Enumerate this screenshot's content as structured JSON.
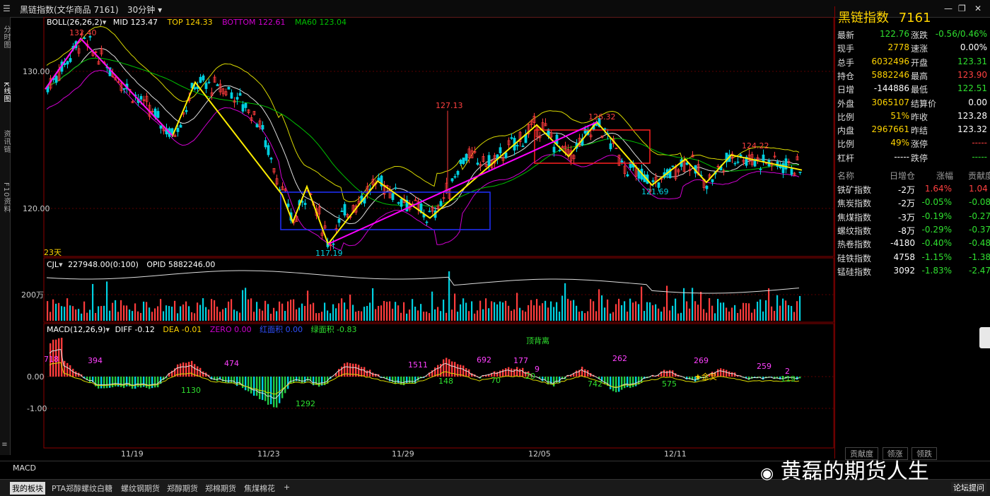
{
  "window": {
    "title": "黑链指数(文华商品 7161)",
    "period": "30分钟",
    "controls": [
      "—",
      "❐",
      "✕"
    ]
  },
  "left_tabs": [
    "分时图",
    "K线图",
    "资讯链",
    "F10资料"
  ],
  "chart": {
    "boll_legend": {
      "name": "BOLL(26,26,2)",
      "mid": "MID 123.47",
      "top": "TOP 124.33",
      "bottom": "BOTTOM 122.61",
      "ma60": "MA60 123.04"
    },
    "price_ticks": [
      "130.00",
      "120.00"
    ],
    "date_ticks": [
      "11/19",
      "11/23",
      "11/29",
      "12/05",
      "12/11"
    ],
    "days_label": "23天",
    "price_labels": {
      "high1": "132.40",
      "low1": "117.19",
      "spike": "127.13",
      "high2": "126.32",
      "low2": "121.69",
      "high3": "124.22"
    },
    "vol_legend": {
      "name": "CJL",
      "value": "227948.00(0:100)",
      "opid": "OPID 5882246.00"
    },
    "vol_tick": "200万",
    "macd_legend": {
      "name": "MACD(12,26,9)",
      "diff": "DIFF -0.12",
      "dea": "DEA -0.01",
      "zero": "ZERO 0.00",
      "red_area": "红面积 0.00",
      "green_area": "绿面积 -0.83"
    },
    "macd_ticks": [
      "0.00",
      "-1.00"
    ],
    "macd_annotations": [
      "718",
      "394",
      "1130",
      "474",
      "1292",
      "1511",
      "148",
      "692",
      "70",
      "177",
      "9",
      "20",
      "顶背离",
      "742",
      "262",
      "575",
      "269",
      "★金叉",
      "259",
      "2",
      "119"
    ]
  },
  "chart_data": {
    "type": "candlestick",
    "title": "黑链指数(文华商品 7161)",
    "period": "30分钟",
    "x_labels": [
      "11/19",
      "11/23",
      "11/29",
      "12/05",
      "12/11"
    ],
    "price_range": [
      116.5,
      133
    ],
    "key_points": [
      {
        "label": "132.40",
        "kind": "high"
      },
      {
        "label": "117.19",
        "kind": "low"
      },
      {
        "label": "127.13",
        "kind": "spike"
      },
      {
        "label": "126.32",
        "kind": "high"
      },
      {
        "label": "121.69",
        "kind": "low"
      },
      {
        "label": "124.22",
        "kind": "high"
      }
    ],
    "indicators": {
      "BOLL": {
        "MID": 123.47,
        "TOP": 124.33,
        "BOTTOM": 122.61,
        "MA60": 123.04
      },
      "CJL": 227948.0,
      "OPID": 5882246.0,
      "MACD": {
        "DIFF": -0.12,
        "DEA": -0.01,
        "ZERO": 0.0
      }
    }
  },
  "quote": {
    "title": "黑链指数",
    "code": "7161",
    "rows": [
      {
        "l1": "最新",
        "v1": "122.76",
        "c1": "green",
        "l2": "涨跌",
        "v2": "-0.56/0.46%",
        "c2": "green"
      },
      {
        "l1": "现手",
        "v1": "2778",
        "c1": "yel",
        "l2": "速涨",
        "v2": "0.00%",
        "c2": "white"
      },
      {
        "l1": "总手",
        "v1": "6032496",
        "c1": "yel",
        "l2": "开盘",
        "v2": "123.31",
        "c2": "green"
      },
      {
        "l1": "持仓",
        "v1": "5882246",
        "c1": "yel",
        "l2": "最高",
        "v2": "123.90",
        "c2": "red"
      },
      {
        "l1": "日增",
        "v1": "-144886",
        "c1": "white",
        "l2": "最低",
        "v2": "122.51",
        "c2": "green"
      },
      {
        "l1": "外盘",
        "v1": "3065107",
        "c1": "yel",
        "l2": "结算价",
        "v2": "0.00",
        "c2": "white"
      },
      {
        "l1": "比例",
        "v1": "51%",
        "c1": "yel",
        "l2": "昨收",
        "v2": "123.28",
        "c2": "white"
      },
      {
        "l1": "内盘",
        "v1": "2967661",
        "c1": "yel",
        "l2": "昨结",
        "v2": "123.32",
        "c2": "white"
      },
      {
        "l1": "比例",
        "v1": "49%",
        "c1": "yel",
        "l2": "涨停",
        "v2": "-----",
        "c2": "red"
      },
      {
        "l1": "杠杆",
        "v1": "-----",
        "c1": "white",
        "l2": "跌停",
        "v2": "-----",
        "c2": "green"
      }
    ],
    "index_header": [
      "名称",
      "日增仓",
      "涨幅",
      "贡献度"
    ],
    "index_rows": [
      {
        "name": "铁矿指数",
        "chg": "-2万",
        "pct": "1.64%",
        "pc": "red",
        "contrib": "1.04",
        "cc": "red"
      },
      {
        "name": "焦炭指数",
        "chg": "-2万",
        "pct": "-0.05%",
        "pc": "green",
        "contrib": "-0.08",
        "cc": "green"
      },
      {
        "name": "焦煤指数",
        "chg": "-3万",
        "pct": "-0.19%",
        "pc": "green",
        "contrib": "-0.27",
        "cc": "green"
      },
      {
        "name": "螺纹指数",
        "chg": "-8万",
        "pct": "-0.29%",
        "pc": "green",
        "contrib": "-0.37",
        "cc": "green"
      },
      {
        "name": "热卷指数",
        "chg": "-4180",
        "pct": "-0.40%",
        "pc": "green",
        "contrib": "-0.48",
        "cc": "green"
      },
      {
        "name": "硅铁指数",
        "chg": "4758",
        "pct": "-1.15%",
        "pc": "green",
        "contrib": "-1.38",
        "cc": "green"
      },
      {
        "name": "锰硅指数",
        "chg": "3092",
        "pct": "-1.83%",
        "pc": "green",
        "contrib": "-2.47",
        "cc": "green"
      }
    ],
    "tabs": [
      "贡献度",
      "领涨",
      "领跌"
    ]
  },
  "bottom": {
    "indicator_label": "MACD",
    "tabs": [
      "我的板块",
      "PTA郑醇螺纹白糖",
      "螺纹钢期货",
      "郑醇期货",
      "郑棉期货",
      "焦煤棉花",
      "+"
    ],
    "watermark": "黄磊的期货人生",
    "forum": "论坛提问"
  },
  "colors": {
    "up": "#ff3c3c",
    "down": "#00d0e0",
    "boll_top": "#d9d900",
    "boll_bottom": "#d000d0",
    "ma60": "#00c000",
    "arrow": "#ffee00",
    "trend": "#ff00ff",
    "box_blue": "#2030ff",
    "box_red": "#ff2020"
  }
}
